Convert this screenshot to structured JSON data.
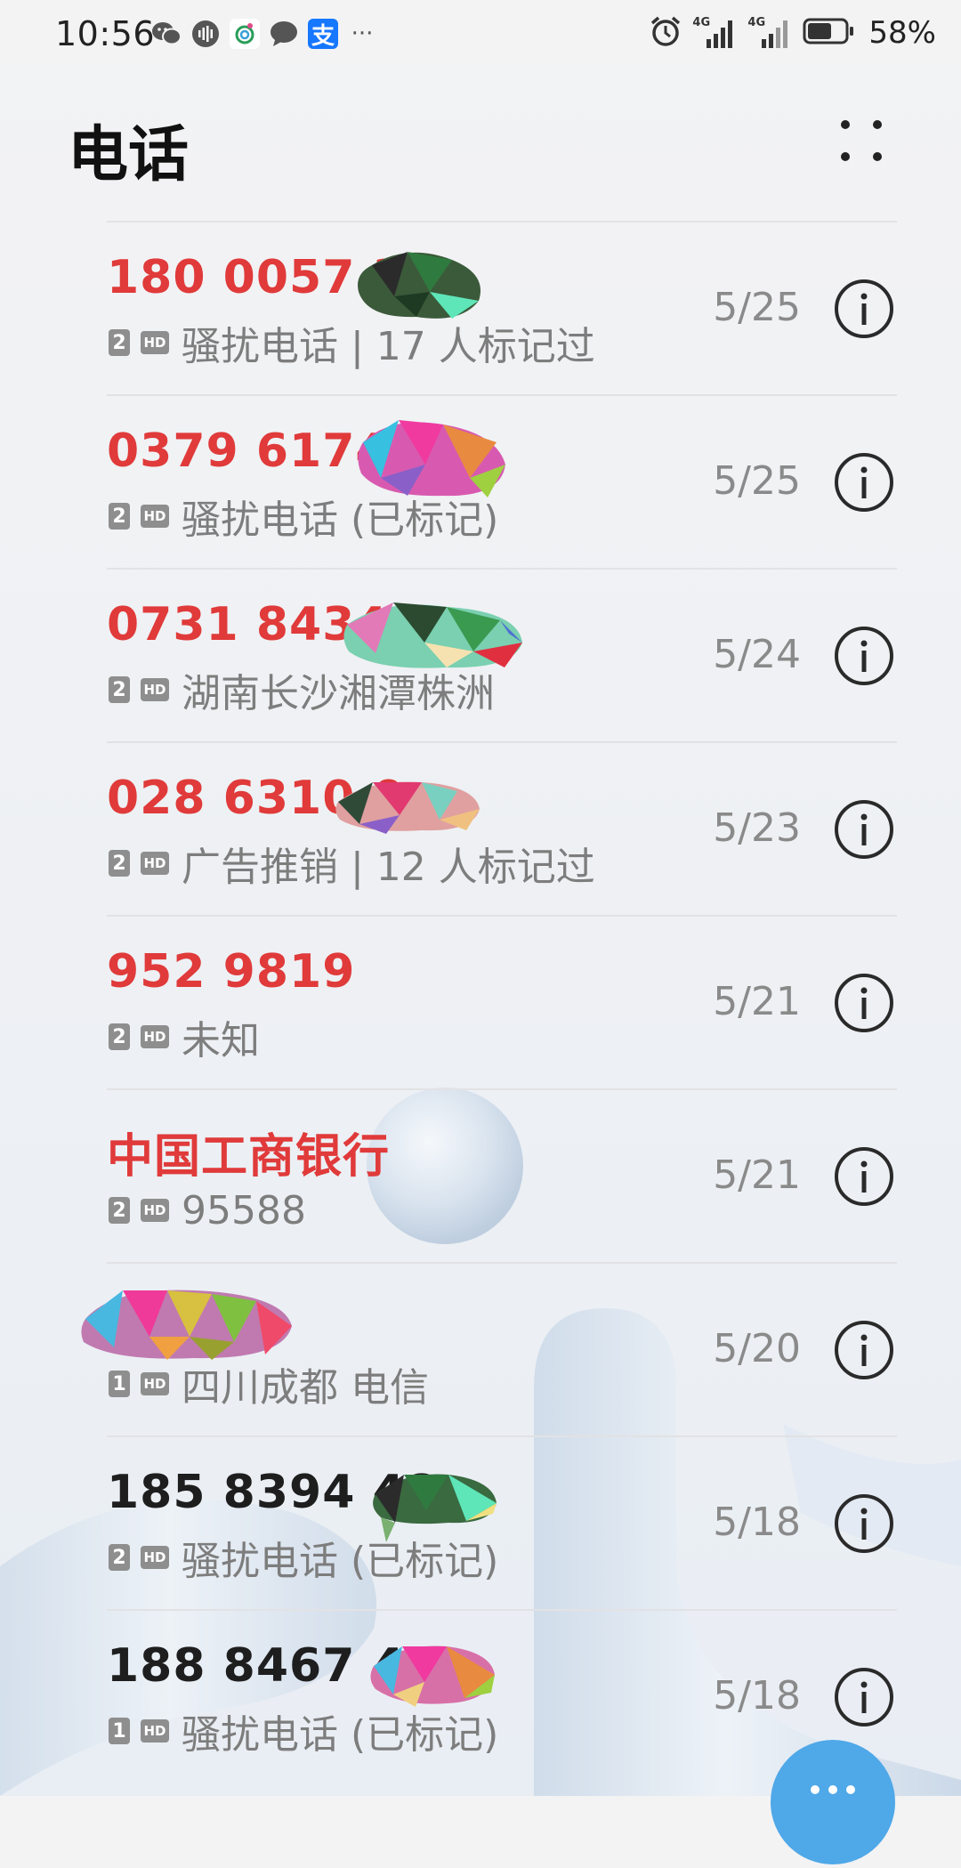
{
  "status_bar": {
    "time": "10:56",
    "left_icons": [
      "wechat-icon",
      "voice-icon",
      "mobile-operator-icon",
      "message-icon",
      "alipay-icon",
      "more-notifications-icon"
    ],
    "right_icons": [
      "alarm-icon",
      "signal-4g-icon",
      "signal-4g-icon",
      "battery-icon"
    ],
    "battery_percent": "58%",
    "battery_level": 0.58,
    "network_label_1": "4G",
    "network_label_2": "4G",
    "alipay_glyph": "支",
    "more_dots": "···"
  },
  "header": {
    "title": "电话",
    "more_icon": "dots-grid-icon"
  },
  "calls": [
    {
      "name": "180 0057 3",
      "name_color": "red",
      "sim": "2",
      "hd": "HD",
      "desc": "骚扰电话 | 17 人标记过",
      "date": "5/25"
    },
    {
      "name": "0379 6174",
      "name_color": "red",
      "sim": "2",
      "hd": "HD",
      "desc": "骚扰电话 (已标记)",
      "date": "5/25"
    },
    {
      "name": "0731 8434",
      "name_color": "red",
      "sim": "2",
      "hd": "HD",
      "desc": "湖南长沙湘潭株洲",
      "date": "5/24"
    },
    {
      "name": "028 6310 0",
      "name_color": "red",
      "sim": "2",
      "hd": "HD",
      "desc": "广告推销 | 12 人标记过",
      "date": "5/23"
    },
    {
      "name": "952 9819",
      "name_color": "red",
      "sim": "2",
      "hd": "HD",
      "desc": "未知",
      "date": "5/21"
    },
    {
      "name": "中国工商银行",
      "name_color": "red",
      "sim": "2",
      "hd": "HD",
      "desc": "95588",
      "date": "5/21"
    },
    {
      "name": "",
      "name_color": "dark",
      "sim": "1",
      "hd": "HD",
      "desc": "四川成都 电信",
      "date": "5/20"
    },
    {
      "name": "185 8394 48",
      "name_color": "dark",
      "sim": "2",
      "hd": "HD",
      "desc": "骚扰电话 (已标记)",
      "date": "5/18"
    },
    {
      "name": "188 8467 46",
      "name_color": "dark",
      "sim": "1",
      "hd": "HD",
      "desc": "骚扰电话 (已标记)",
      "date": "5/18"
    }
  ],
  "fab": {
    "icon": "more-dots-icon",
    "color": "#4fa8e8"
  },
  "colors": {
    "missed_call": "#e03a3a",
    "normal_call": "#1e1e1e",
    "meta_text": "#7d7d7d",
    "accent": "#4fa8e8"
  }
}
